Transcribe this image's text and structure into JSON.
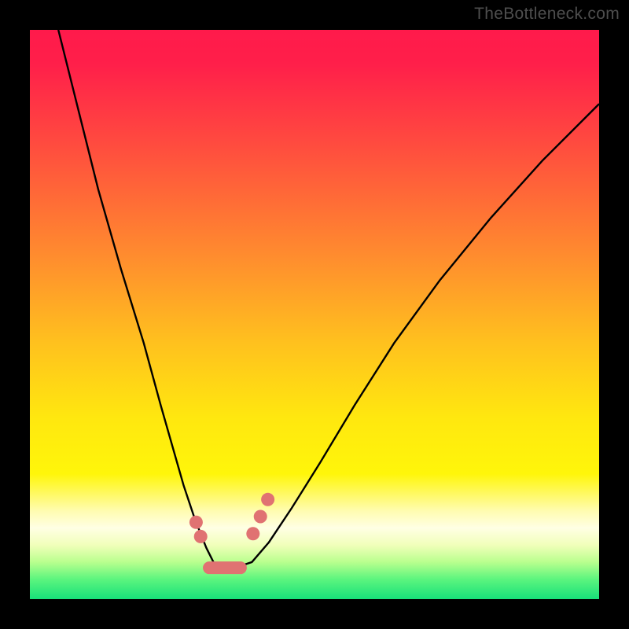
{
  "watermark": "TheBottleneck.com",
  "chart_data": {
    "type": "line",
    "title": "",
    "xlabel": "",
    "ylabel": "",
    "xlim": [
      0,
      100
    ],
    "ylim": [
      0,
      100
    ],
    "grid": false,
    "legend": false,
    "background_gradient": {
      "stops": [
        {
          "offset": 0.0,
          "color": "#ff1a4b"
        },
        {
          "offset": 0.06,
          "color": "#ff1f4a"
        },
        {
          "offset": 0.2,
          "color": "#ff4b3f"
        },
        {
          "offset": 0.4,
          "color": "#ff8d2e"
        },
        {
          "offset": 0.55,
          "color": "#ffc11e"
        },
        {
          "offset": 0.68,
          "color": "#ffe70f"
        },
        {
          "offset": 0.78,
          "color": "#fff60a"
        },
        {
          "offset": 0.845,
          "color": "#fffcb0"
        },
        {
          "offset": 0.875,
          "color": "#ffffe4"
        },
        {
          "offset": 0.905,
          "color": "#f1ffba"
        },
        {
          "offset": 0.935,
          "color": "#b9ff8e"
        },
        {
          "offset": 0.965,
          "color": "#5cf57e"
        },
        {
          "offset": 1.0,
          "color": "#17e07a"
        }
      ]
    },
    "series": [
      {
        "name": "bottleneck-curve",
        "color": "#000000",
        "x": [
          5,
          8,
          12,
          16,
          20,
          23,
          25,
          27,
          29,
          31,
          32.5,
          36,
          39,
          42,
          46,
          51,
          57,
          64,
          72,
          81,
          90,
          100
        ],
        "y": [
          100,
          88,
          72,
          58,
          45,
          34,
          27,
          20,
          14,
          9,
          6,
          5.5,
          6.5,
          10,
          16,
          24,
          34,
          45,
          56,
          67,
          77,
          87
        ]
      }
    ],
    "markers": {
      "color": "#e07272",
      "flat_segment": {
        "x_start": 31.5,
        "x_end": 37,
        "y": 5.5
      },
      "points": [
        {
          "x": 29.2,
          "y": 13.5
        },
        {
          "x": 30.0,
          "y": 11.0
        },
        {
          "x": 39.2,
          "y": 11.5
        },
        {
          "x": 40.5,
          "y": 14.5
        },
        {
          "x": 41.8,
          "y": 17.5
        }
      ]
    }
  }
}
